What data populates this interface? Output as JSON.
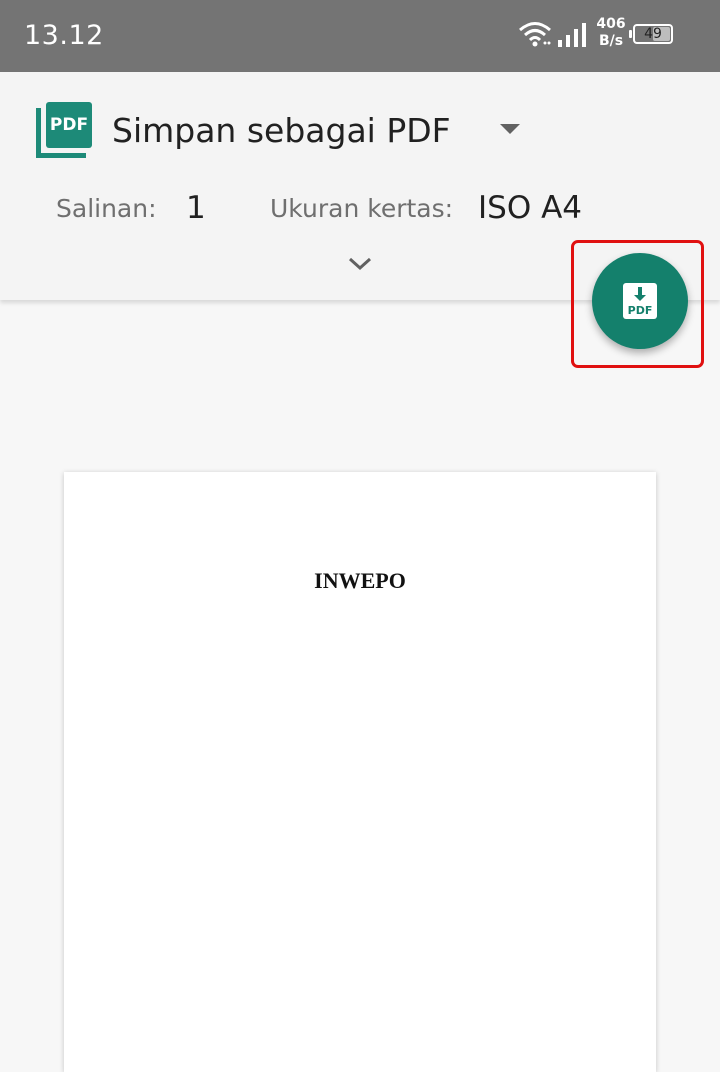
{
  "status_bar": {
    "time": "13.12",
    "net_speed_value": "406",
    "net_speed_unit": "B/s",
    "battery_level": "49",
    "icons": [
      "wifi-icon",
      "signal-icon",
      "battery-icon"
    ]
  },
  "print_settings": {
    "printer_name": "Simpan sebagai PDF",
    "copies_label": "Salinan:",
    "copies_value": "1",
    "paper_size_label": "Ukuran kertas:",
    "paper_size_value": "ISO A4",
    "icons": [
      "pdf-printer-icon",
      "dropdown-arrow-icon",
      "expand-chevron-icon"
    ]
  },
  "fab": {
    "icon": "download-pdf-icon",
    "icon_text": "PDF",
    "accent_color": "#14806c",
    "highlight_color": "#e01010"
  },
  "preview": {
    "document_title": "INWEPO"
  }
}
